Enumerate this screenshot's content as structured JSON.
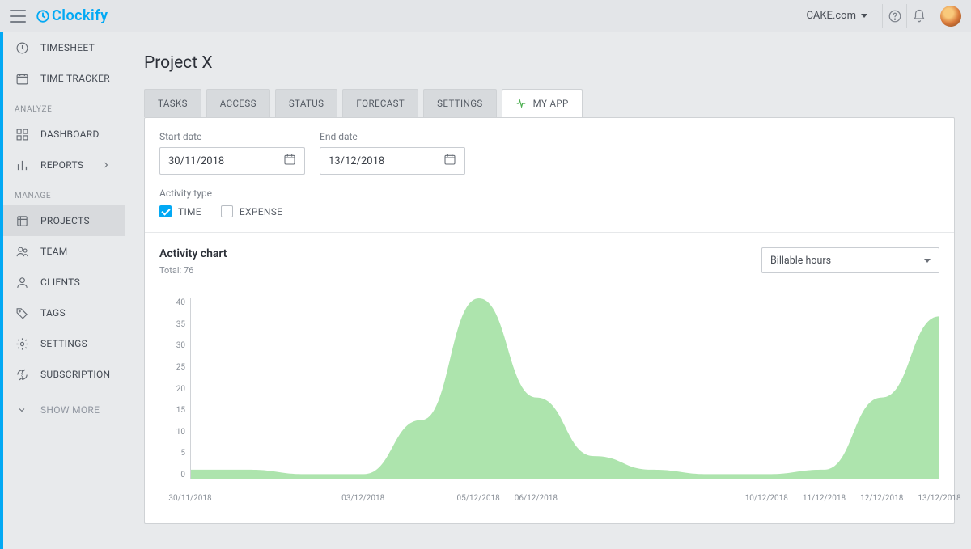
{
  "header": {
    "logo_text": "Clockify",
    "workspace": "CAKE.com"
  },
  "sidebar": {
    "groups": [
      {
        "items": [
          {
            "id": "timesheet",
            "label": "TIMESHEET"
          },
          {
            "id": "timetracker",
            "label": "TIME TRACKER"
          }
        ]
      },
      {
        "title": "ANALYZE",
        "items": [
          {
            "id": "dashboard",
            "label": "DASHBOARD"
          },
          {
            "id": "reports",
            "label": "REPORTS",
            "expandable": true
          }
        ]
      },
      {
        "title": "MANAGE",
        "items": [
          {
            "id": "projects",
            "label": "PROJECTS",
            "active": true
          },
          {
            "id": "team",
            "label": "TEAM"
          },
          {
            "id": "clients",
            "label": "CLIENTS"
          },
          {
            "id": "tags",
            "label": "TAGS"
          },
          {
            "id": "settings",
            "label": "SETTINGS"
          },
          {
            "id": "subscription",
            "label": "SUBSCRIPTION"
          }
        ]
      }
    ],
    "show_more": "SHOW MORE"
  },
  "page": {
    "title": "Project X"
  },
  "tabs": [
    {
      "id": "tasks",
      "label": "TASKS"
    },
    {
      "id": "access",
      "label": "ACCESS"
    },
    {
      "id": "status",
      "label": "STATUS"
    },
    {
      "id": "forecast",
      "label": "FORECAST"
    },
    {
      "id": "settings",
      "label": "SETTINGS"
    },
    {
      "id": "myapp",
      "label": "MY APP",
      "active": true,
      "icon": true
    }
  ],
  "filters": {
    "start_label": "Start date",
    "start_value": "30/11/2018",
    "end_label": "End date",
    "end_value": "13/12/2018",
    "activity_label": "Activity type",
    "time_label": "TIME",
    "time_checked": true,
    "expense_label": "EXPENSE",
    "expense_checked": false
  },
  "chart": {
    "title": "Activity chart",
    "total_label": "Total: 76",
    "metric": "Billable hours"
  },
  "chart_data": {
    "type": "area",
    "title": "Activity chart",
    "ylabel": "",
    "xlabel": "",
    "ylim": [
      0,
      40
    ],
    "y_ticks": [
      0,
      5,
      10,
      15,
      20,
      25,
      30,
      35,
      40
    ],
    "x_ticks": [
      "30/11/2018",
      "03/12/2018",
      "05/12/2018",
      "06/12/2018",
      "10/12/2018",
      "11/12/2018",
      "12/12/2018",
      "13/12/2018"
    ],
    "x": [
      "30/11/2018",
      "01/12/2018",
      "02/12/2018",
      "03/12/2018",
      "04/12/2018",
      "05/12/2018",
      "06/12/2018",
      "07/12/2018",
      "08/12/2018",
      "09/12/2018",
      "10/12/2018",
      "11/12/2018",
      "12/12/2018",
      "13/12/2018"
    ],
    "values": [
      2,
      2,
      1,
      1,
      13,
      40,
      18,
      5,
      2,
      1,
      1,
      2,
      18,
      36
    ],
    "color": "#9fdf9f"
  }
}
